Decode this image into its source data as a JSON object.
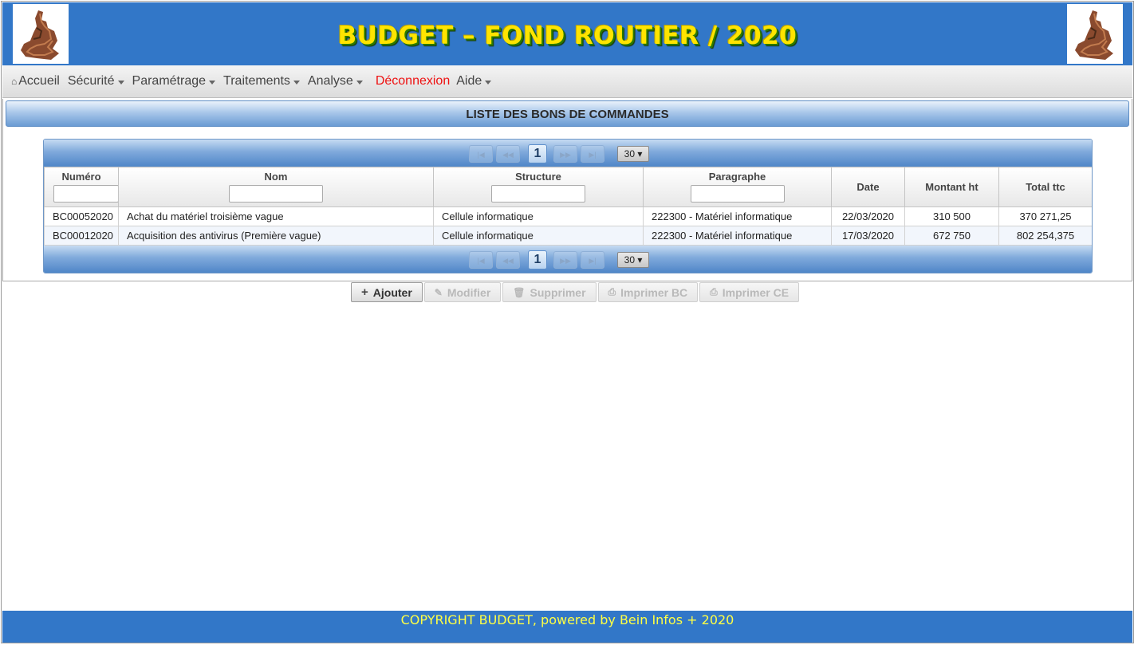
{
  "header": {
    "title": "BUDGET – FOND ROUTIER / 2020"
  },
  "menu": {
    "home": "Accueil",
    "items": [
      "Sécurité",
      "Paramétrage",
      "Traitements",
      "Analyse"
    ],
    "logout": "Déconnexion",
    "help": "Aide"
  },
  "panel": {
    "title": "LISTE DES BONS DE COMMANDES"
  },
  "pagination": {
    "current_page": "1",
    "rows_per_page": "30 ▾"
  },
  "table": {
    "columns": [
      "Numéro",
      "Nom",
      "Structure",
      "Paragraphe",
      "Date",
      "Montant ht",
      "Total ttc"
    ],
    "rows": [
      [
        "BC00052020",
        "Achat du matériel troisième vague",
        "Cellule informatique",
        "222300 - Matériel informatique",
        "22/03/2020",
        "310 500",
        "370 271,25"
      ],
      [
        "BC00012020",
        "Acquisition des antivirus (Première vague)",
        "Cellule informatique",
        "222300 - Matériel informatique",
        "17/03/2020",
        "672 750",
        "802 254,375"
      ]
    ]
  },
  "actions": {
    "add": "Ajouter",
    "edit": "Modifier",
    "delete": "Supprimer",
    "print_bc": "Imprimer BC",
    "print_ce": "Imprimer CE"
  },
  "footer": {
    "text": "COPYRIGHT BUDGET, powered by Bein Infos + 2020"
  },
  "colors": {
    "brand_blue": "#3277c8",
    "title_yellow": "#ffe400",
    "logout_red": "#ee1111"
  },
  "icons": [
    "home-icon",
    "caret-down-icon",
    "plus-icon",
    "pencil-icon",
    "trash-icon",
    "printer-icon"
  ]
}
